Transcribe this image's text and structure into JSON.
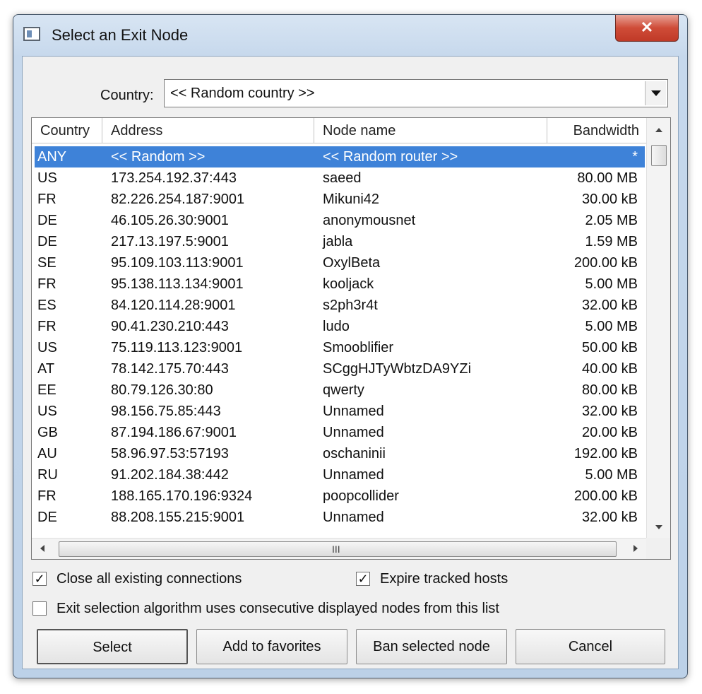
{
  "window": {
    "title": "Select an Exit Node",
    "close_glyph": "✕"
  },
  "country": {
    "label": "Country:",
    "selected": "<< Random country >>"
  },
  "table": {
    "columns": [
      "Country",
      "Address",
      "Node name",
      "Bandwidth"
    ],
    "rows": [
      {
        "country": "ANY",
        "address": "<< Random >>",
        "node": "<< Random router >>",
        "bandwidth": "*",
        "selected": true
      },
      {
        "country": "US",
        "address": "173.254.192.37:443",
        "node": "saeed",
        "bandwidth": "80.00 MB"
      },
      {
        "country": "FR",
        "address": "82.226.254.187:9001",
        "node": "Mikuni42",
        "bandwidth": "30.00 kB"
      },
      {
        "country": "DE",
        "address": "46.105.26.30:9001",
        "node": "anonymousnet",
        "bandwidth": "2.05 MB"
      },
      {
        "country": "DE",
        "address": "217.13.197.5:9001",
        "node": "jabla",
        "bandwidth": "1.59 MB"
      },
      {
        "country": "SE",
        "address": "95.109.103.113:9001",
        "node": "OxylBeta",
        "bandwidth": "200.00 kB"
      },
      {
        "country": "FR",
        "address": "95.138.113.134:9001",
        "node": "kooljack",
        "bandwidth": "5.00 MB"
      },
      {
        "country": "ES",
        "address": "84.120.114.28:9001",
        "node": "s2ph3r4t",
        "bandwidth": "32.00 kB"
      },
      {
        "country": "FR",
        "address": "90.41.230.210:443",
        "node": "ludo",
        "bandwidth": "5.00 MB"
      },
      {
        "country": "US",
        "address": "75.119.113.123:9001",
        "node": "Smooblifier",
        "bandwidth": "50.00 kB"
      },
      {
        "country": "AT",
        "address": "78.142.175.70:443",
        "node": "SCggHJTyWbtzDA9YZi",
        "bandwidth": "40.00 kB"
      },
      {
        "country": "EE",
        "address": "80.79.126.30:80",
        "node": "qwerty",
        "bandwidth": "80.00 kB"
      },
      {
        "country": "US",
        "address": "98.156.75.85:443",
        "node": "Unnamed",
        "bandwidth": "32.00 kB"
      },
      {
        "country": "GB",
        "address": "87.194.186.67:9001",
        "node": "Unnamed",
        "bandwidth": "20.00 kB"
      },
      {
        "country": "AU",
        "address": "58.96.97.53:57193",
        "node": "oschaninii",
        "bandwidth": "192.00 kB"
      },
      {
        "country": "RU",
        "address": "91.202.184.38:442",
        "node": "Unnamed",
        "bandwidth": "5.00 MB"
      },
      {
        "country": "FR",
        "address": "188.165.170.196:9324",
        "node": "poopcollider",
        "bandwidth": "200.00 kB"
      },
      {
        "country": "DE",
        "address": "88.208.155.215:9001",
        "node": "Unnamed",
        "bandwidth": "32.00 kB"
      }
    ],
    "hscroll_grip": "III"
  },
  "options": {
    "close_connections": {
      "label": "Close all existing connections",
      "checked": true
    },
    "expire_hosts": {
      "label": "Expire tracked hosts",
      "checked": true
    },
    "consecutive": {
      "label": "Exit selection algorithm uses consecutive displayed nodes from this list",
      "checked": false
    }
  },
  "buttons": {
    "select": "Select",
    "favorites": "Add to favorites",
    "ban": "Ban selected node",
    "cancel": "Cancel"
  },
  "colors": {
    "selection": "#3e82d8",
    "close_button": "#cf4c38"
  }
}
